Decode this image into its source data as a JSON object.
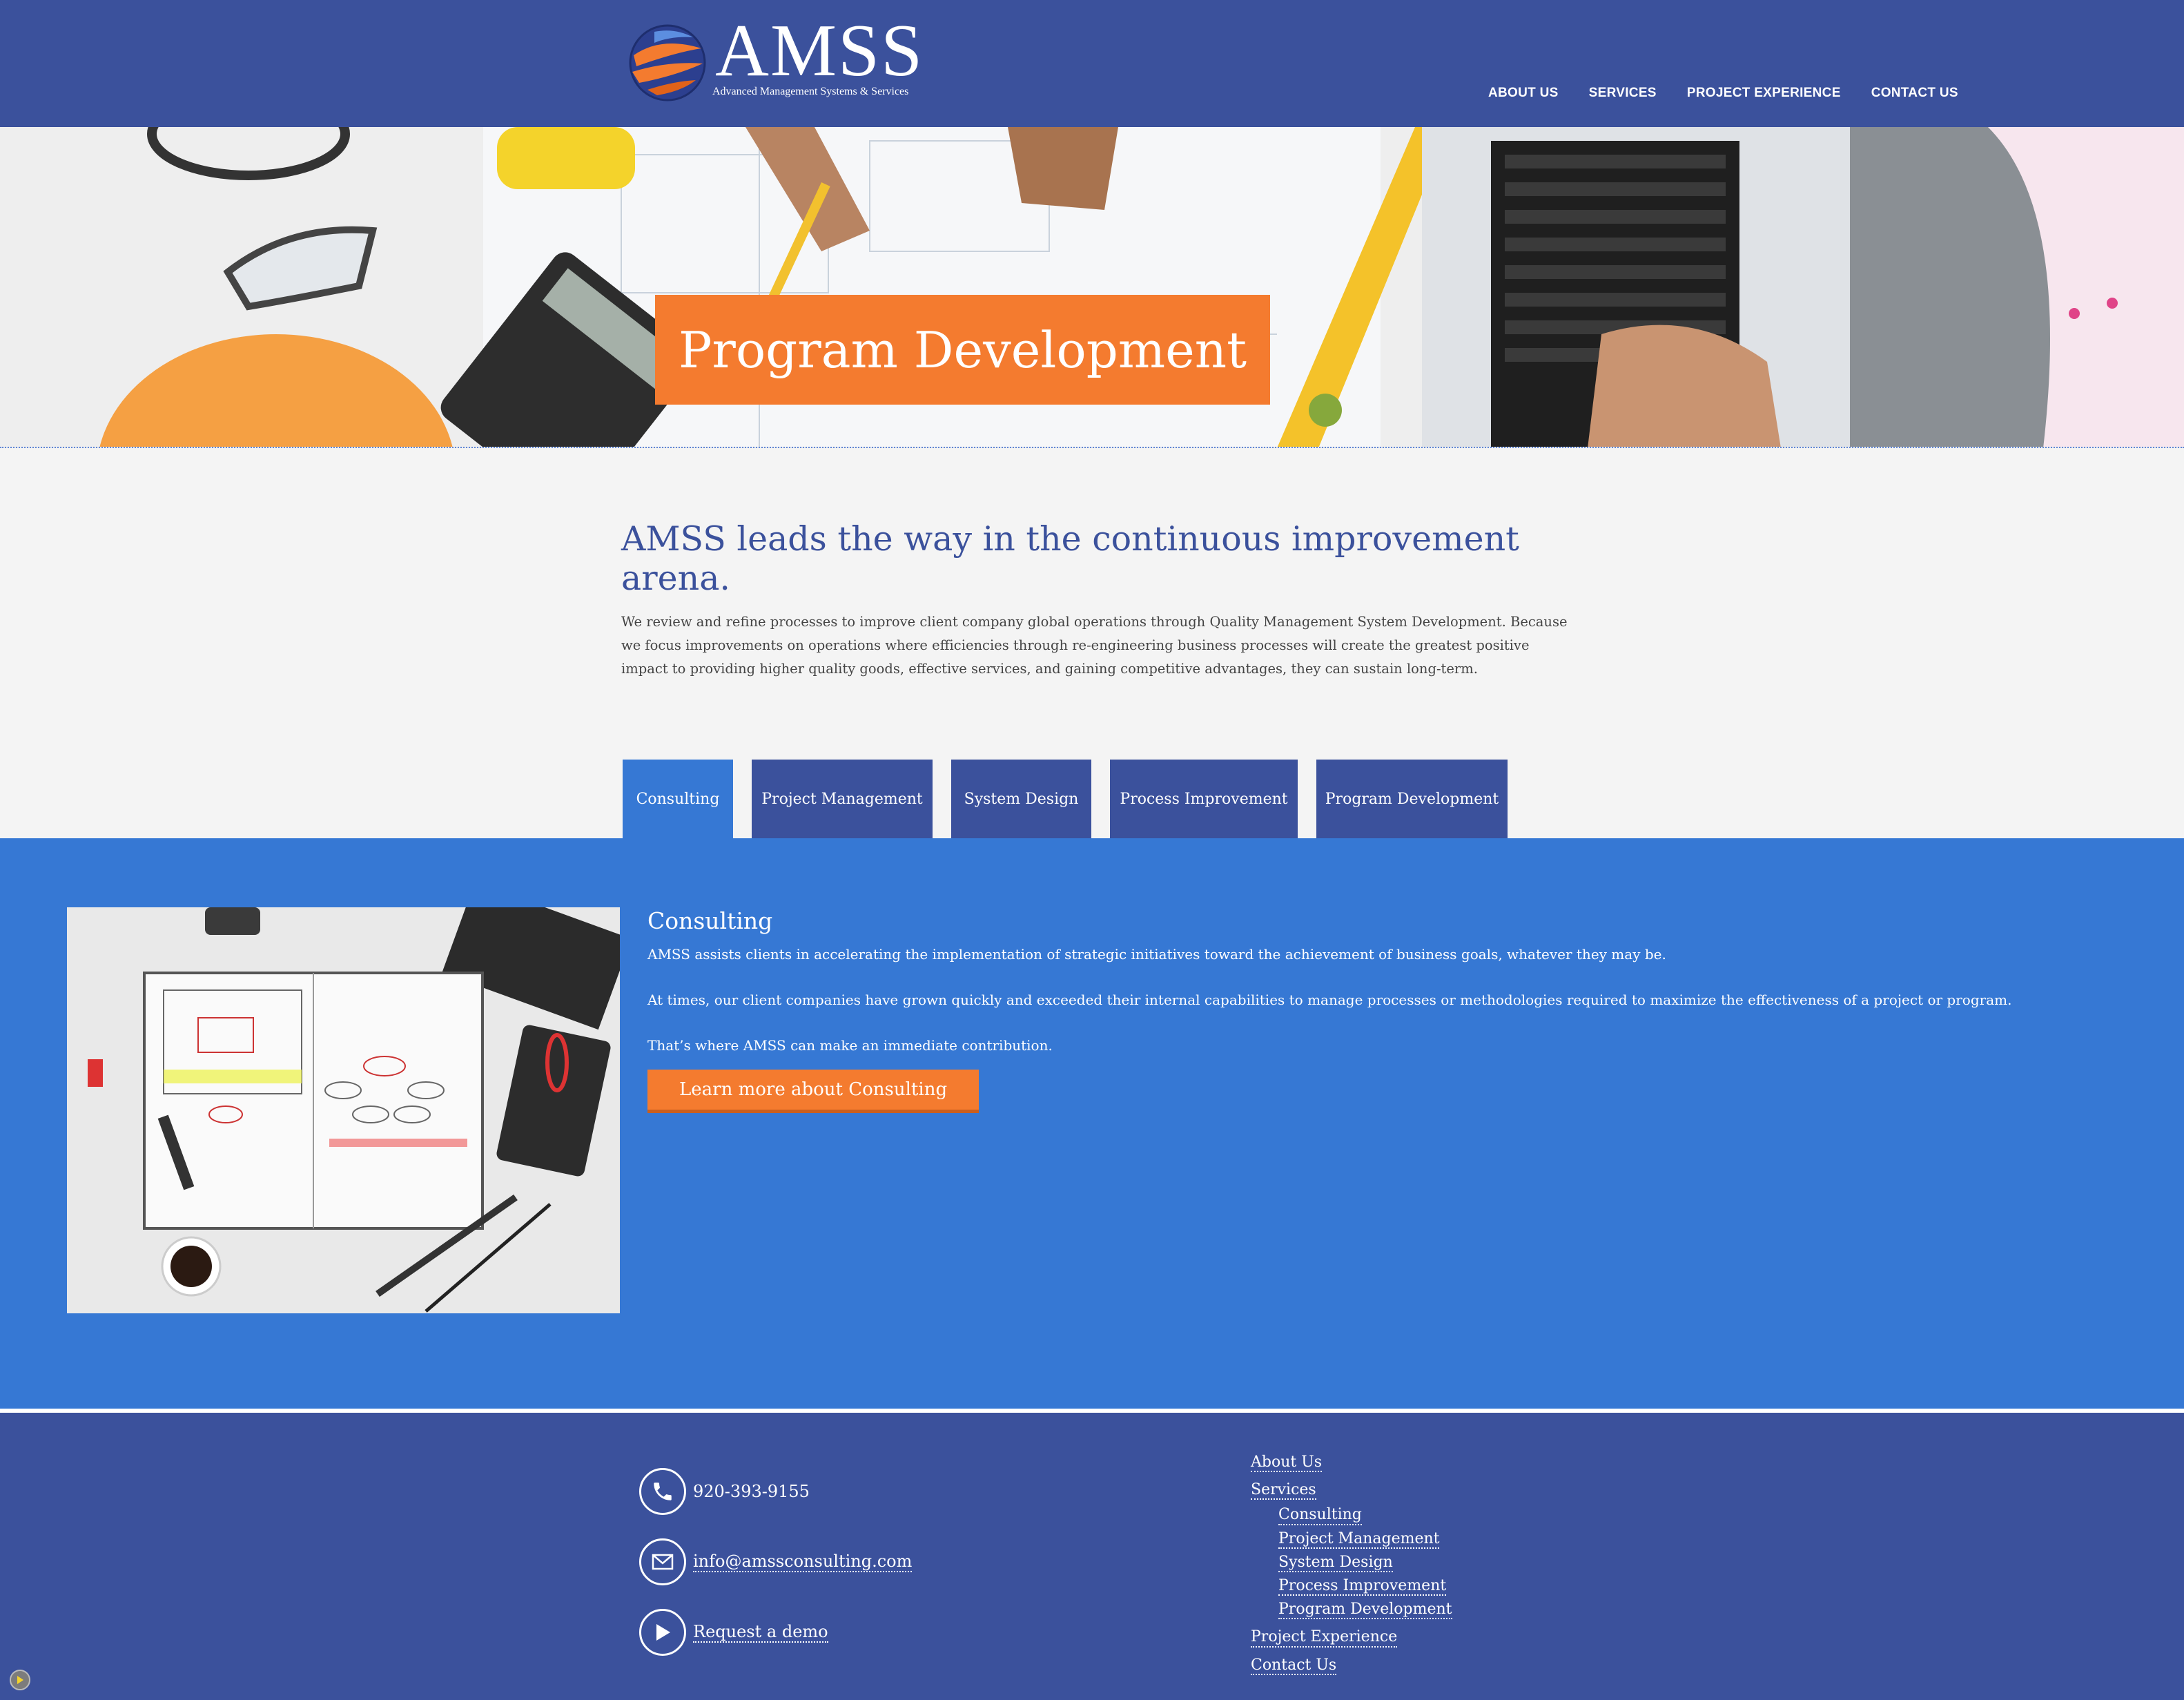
{
  "brand": {
    "name": "AMSS",
    "tagline": "Advanced Management Systems & Services"
  },
  "nav": {
    "items": [
      "ABOUT US",
      "SERVICES",
      "PROJECT EXPERIENCE",
      "CONTACT US"
    ]
  },
  "hero": {
    "title": "Program Development"
  },
  "intro": {
    "heading": "AMSS leads the way in the continuous improvement arena.",
    "body": "We review and refine processes to improve client company global operations through Quality Management System Development. Because we focus improvements on operations where efficiencies through re-engineering business processes will create the greatest positive impact to providing higher quality goods, effective services, and gaining competitive advantages, they can sustain long-term."
  },
  "tabs": {
    "items": [
      {
        "label": "Consulting",
        "active": true
      },
      {
        "label": "Project Management",
        "active": false
      },
      {
        "label": "System Design",
        "active": false
      },
      {
        "label": "Process Improvement",
        "active": false
      },
      {
        "label": "Program Development",
        "active": false
      }
    ]
  },
  "panel": {
    "title": "Consulting",
    "paragraphs": [
      "AMSS assists clients in accelerating the implementation of strategic initiatives toward the achievement of business goals, whatever they may be.",
      "At times, our client companies have grown quickly and exceeded their internal capabilities to manage processes or methodologies required to maximize the effectiveness of a project or program.",
      "That’s where AMSS can make an immediate contribution."
    ],
    "cta": "Learn more about Consulting"
  },
  "footer": {
    "phone": "920-393-9155",
    "email": "info@amssconsulting.com",
    "demo": "Request a demo",
    "nav": {
      "about": "About Us",
      "services": "Services",
      "sub": [
        "Consulting",
        "Project Management",
        "System Design",
        "Process Improvement",
        "Program Development"
      ],
      "project": "Project Experience",
      "contact": "Contact Us"
    }
  },
  "colors": {
    "header_blue": "#3b519c",
    "panel_blue": "#3678d4",
    "accent_orange": "#f47b2f"
  }
}
